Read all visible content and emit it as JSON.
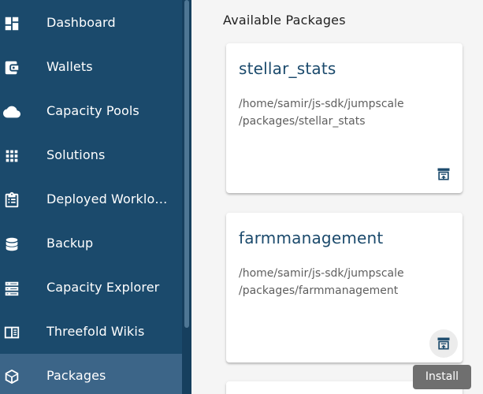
{
  "sidebar": {
    "items": [
      {
        "label": "Dashboard",
        "icon": "dashboard-icon"
      },
      {
        "label": "Wallets",
        "icon": "wallet-icon"
      },
      {
        "label": "Capacity Pools",
        "icon": "cloud-icon"
      },
      {
        "label": "Solutions",
        "icon": "apps-grid-icon"
      },
      {
        "label": "Deployed Worklo…",
        "icon": "clipboard-list-icon"
      },
      {
        "label": "Backup",
        "icon": "database-icon"
      },
      {
        "label": "Capacity Explorer",
        "icon": "server-icon"
      },
      {
        "label": "Threefold Wikis",
        "icon": "book-icon"
      },
      {
        "label": "Packages",
        "icon": "package-icon",
        "active": true
      }
    ]
  },
  "main": {
    "section_title": "Available Packages",
    "cards": [
      {
        "title": "stellar_stats",
        "path_line1": "/home/samir/js-sdk/jumpscale",
        "path_line2": "/packages/stellar_stats",
        "action_icon": "archive-install-icon"
      },
      {
        "title": "farmmanagement",
        "path_line1": "/home/samir/js-sdk/jumpscale",
        "path_line2": "/packages/farmmanagement",
        "action_icon": "archive-install-icon"
      }
    ],
    "tooltip": "Install"
  },
  "colors": {
    "sidebar_bg": "#1b4a6c",
    "sidebar_active": "#3c6588",
    "accent": "#1b4a6c",
    "tooltip_bg": "#6f6f6f"
  }
}
